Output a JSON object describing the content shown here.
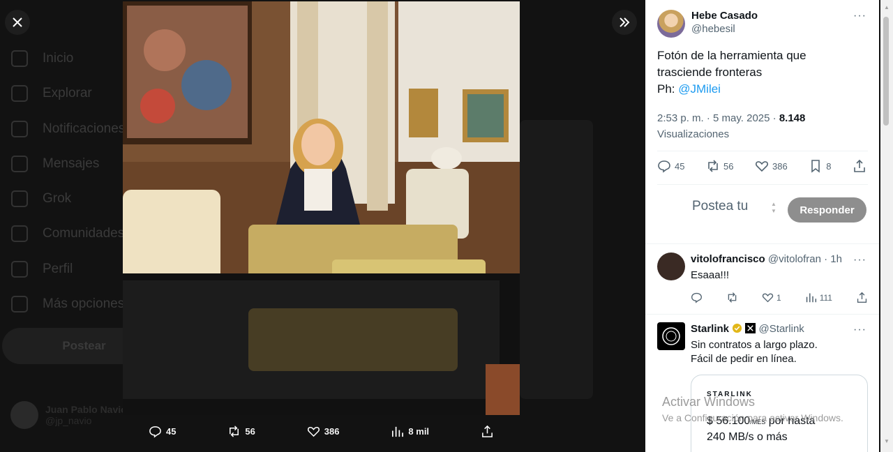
{
  "background_nav": {
    "items": [
      "Inicio",
      "Explorar",
      "Notificaciones",
      "Mensajes",
      "Grok",
      "Comunidades",
      "Perfil",
      "Más opciones"
    ],
    "post_button": "Postear",
    "user_name": "Juan Pablo Navio",
    "user_handle": "@jp_navio"
  },
  "viewer": {
    "actions": {
      "replies": "45",
      "retweets": "56",
      "likes": "386",
      "views": "8 mil"
    }
  },
  "tweet": {
    "author_name": "Hebe Casado",
    "author_handle": "@hebesil",
    "text_line1": "Fotón de la herramienta que",
    "text_line2": "trasciende fronteras",
    "text_prefix": "Ph: ",
    "mention": "@JMilei",
    "time": "2:53 p. m. · 5 may. 2025 · ",
    "views_count": "8.148",
    "views_label": "Visualizaciones",
    "stats": {
      "replies": "45",
      "retweets": "56",
      "likes": "386",
      "bookmarks": "8"
    }
  },
  "reply_box": {
    "placeholder": "Postea tu",
    "button": "Responder"
  },
  "replies": [
    {
      "name": "vitolofrancisco",
      "handle": "@vitolofran",
      "time": "· 1h",
      "text": "Esaaa!!!",
      "likes": "1",
      "views": "111"
    }
  ],
  "ad": {
    "name": "Starlink",
    "handle": "@Starlink",
    "text_line1": "Sin contratos a largo plazo.",
    "text_line2": "Fácil de pedir en línea.",
    "card_brand": "STARLINK",
    "price": "$ 56.100",
    "per": "/MES",
    "price_suffix": " por hasta",
    "speed": "240 MB/s o más"
  },
  "watermark": {
    "line1": "Activar Windows",
    "line2": "Ve a Configuración para activar Windows."
  },
  "colors": {
    "link": "#1d9bf0",
    "verified_gold": "#e2b719",
    "reply_button": "#8e8e8e"
  }
}
